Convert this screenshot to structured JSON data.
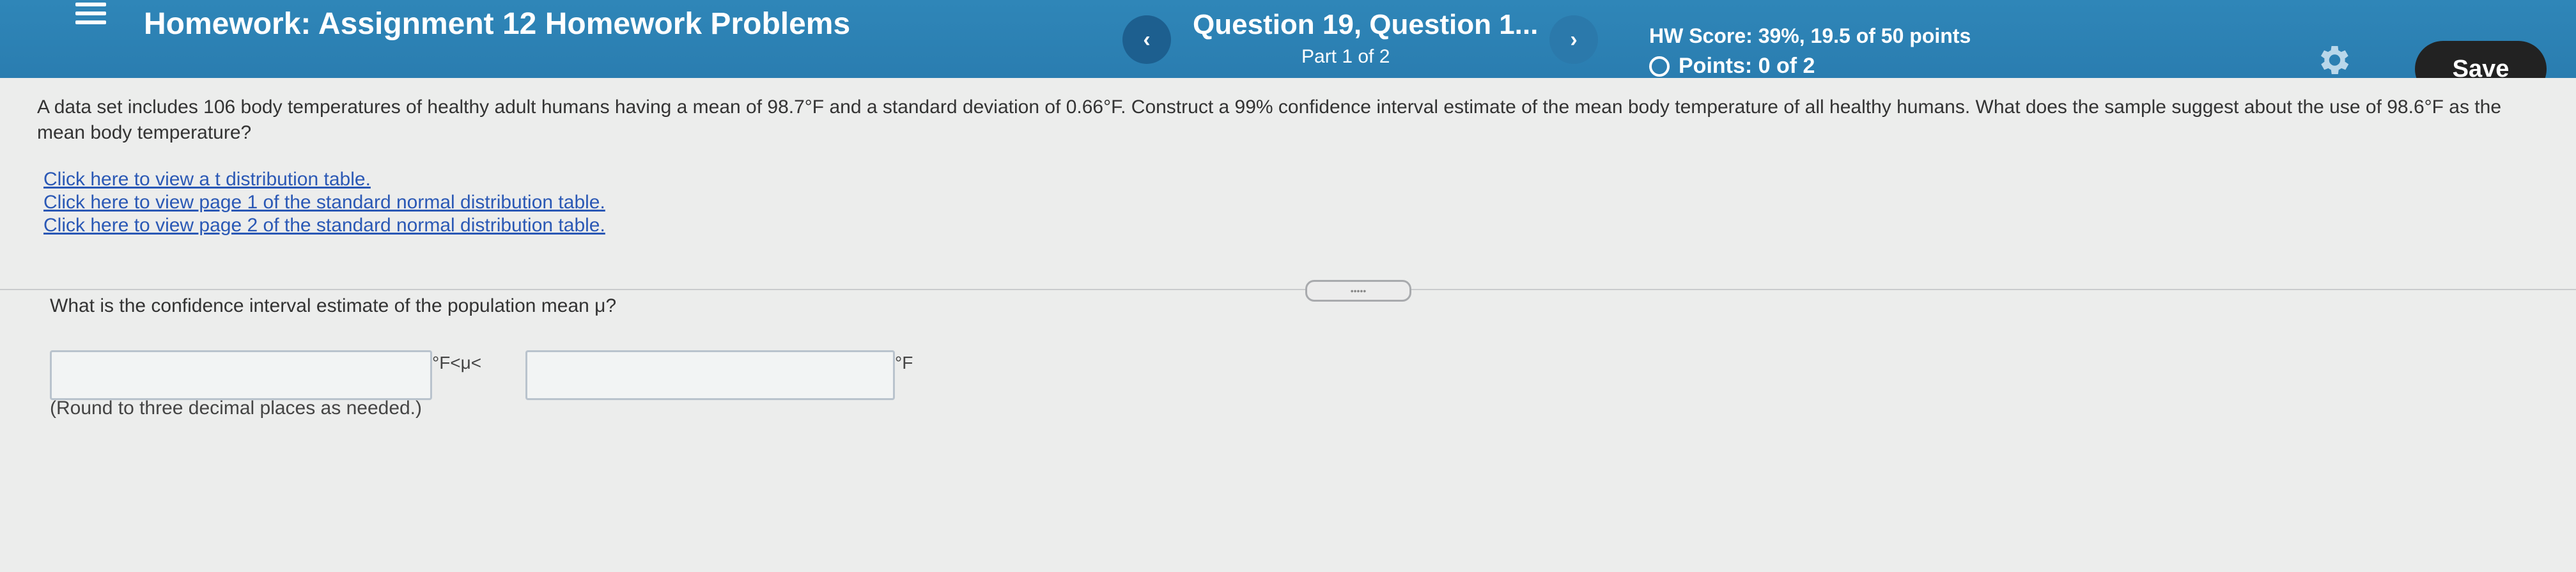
{
  "header": {
    "title": "Homework: Assignment 12 Homework Problems",
    "question_title": "Question 19, Question 1...",
    "question_part": "Part 1 of 2",
    "hw_score": "HW Score: 39%, 19.5 of 50 points",
    "points": "Points: 0 of 2",
    "save_label": "Save",
    "prev_glyph": "‹",
    "next_glyph": "›"
  },
  "problem": {
    "text": "A data set includes 106 body temperatures of healthy adult humans having a mean of 98.7°F and a standard deviation of 0.66°F. Construct a 99% confidence interval estimate of the mean body temperature of all healthy humans. What does the sample suggest about the use of 98.6°F as the mean body temperature?",
    "links": [
      "Click here to view a t distribution table.",
      "Click here to view page 1 of the standard normal distribution table.",
      "Click here to view page 2 of the standard normal distribution table."
    ]
  },
  "question": {
    "prompt": "What is the confidence interval estimate of the population mean μ?",
    "mid_text": "°F<μ<",
    "unit": "°F",
    "hint": "(Round to three decimal places as needed.)",
    "answer1_value": "",
    "answer2_value": ""
  },
  "divider": {
    "handle_text": "•••••"
  },
  "icons": {
    "menu": "menu-icon",
    "gear": "gear-icon",
    "points_status": "circle-icon"
  },
  "colors": {
    "header_bg": "#2f86b8",
    "save_bg": "#222222",
    "link": "#2a58b5"
  }
}
